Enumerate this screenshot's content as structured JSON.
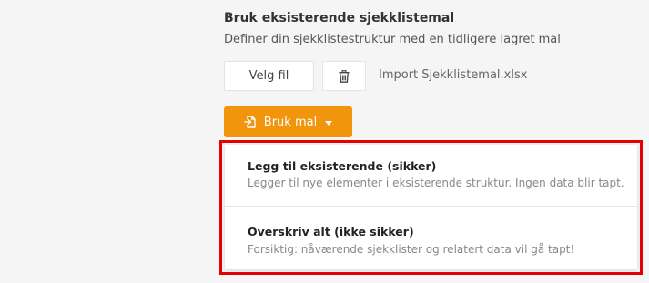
{
  "template_section": {
    "title": "Bruk eksisterende sjekklistemal",
    "description": "Definer din sjekklistestruktur med en tidligere lagret mal"
  },
  "file_picker": {
    "choose_label": "Velg fil",
    "delete_icon": "trash-icon",
    "file_name": "Import Sjekklistemal.xlsx"
  },
  "use_button": {
    "label": "Bruk mal",
    "icon": "file-import-icon",
    "caret_icon": "caret-down-icon",
    "color": "#f0950c"
  },
  "dropdown": {
    "highlight_color": "#e60000",
    "items": [
      {
        "title": "Legg til eksisterende (sikker)",
        "description": "Legger til nye elementer i eksisterende struktur. Ingen data blir tapt."
      },
      {
        "title": "Overskriv alt (ikke sikker)",
        "description": "Forsiktig: nåværende sjekklister og relatert data vil gå tapt!"
      }
    ]
  }
}
